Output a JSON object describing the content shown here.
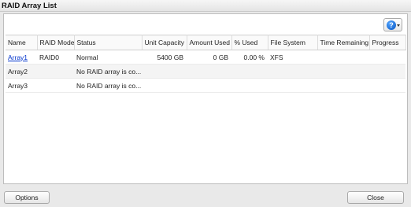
{
  "window": {
    "title": "RAID Array List"
  },
  "help": {
    "glyph": "?",
    "icon": "help-icon"
  },
  "table": {
    "columns": [
      "Name",
      "RAID Mode",
      "Status",
      "Unit Capacity",
      "Amount Used",
      "% Used",
      "File System",
      "Time Remaining",
      "Progress"
    ],
    "rows": [
      {
        "name": "Array1",
        "raid_mode": "RAID0",
        "status": "Normal",
        "unit_capacity": "5400 GB",
        "amount_used": "0 GB",
        "pct_used": "0.00 %",
        "file_system": "XFS",
        "time_remaining": "",
        "progress": ""
      },
      {
        "name": "Array2",
        "raid_mode": "",
        "status": "No RAID array is co...",
        "unit_capacity": "",
        "amount_used": "",
        "pct_used": "",
        "file_system": "",
        "time_remaining": "",
        "progress": ""
      },
      {
        "name": "Array3",
        "raid_mode": "",
        "status": "No RAID array is co...",
        "unit_capacity": "",
        "amount_used": "",
        "pct_used": "",
        "file_system": "",
        "time_remaining": "",
        "progress": ""
      }
    ]
  },
  "footer": {
    "options_label": "Options",
    "close_label": "Close"
  }
}
